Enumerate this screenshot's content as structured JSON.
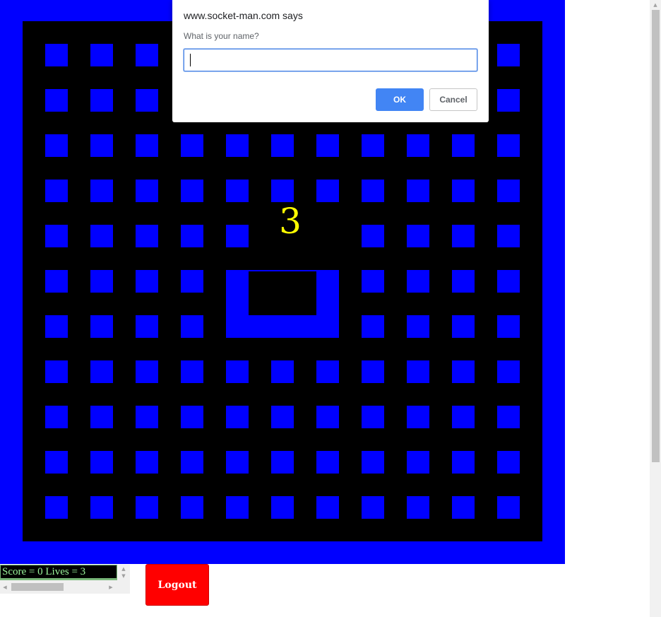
{
  "dialog": {
    "title": "www.socket-man.com says",
    "message": "What is your name?",
    "input_value": "",
    "ok_label": "OK",
    "cancel_label": "Cancel"
  },
  "game": {
    "countdown": "3",
    "maze_grid": {
      "columns": 11,
      "rows": 11,
      "ghost_house_cells": [
        [
          4,
          5
        ],
        [
          4,
          6
        ],
        [
          5,
          5
        ],
        [
          5,
          6
        ],
        [
          6,
          5
        ],
        [
          6,
          6
        ]
      ]
    },
    "colors": {
      "wall": "#0000ff",
      "floor": "#000000",
      "countdown": "#ffff00"
    }
  },
  "status": {
    "score_text": "Score = 0 Lives = 3"
  },
  "controls": {
    "logout_label": "Logout",
    "logout_color": "#ff0000"
  }
}
